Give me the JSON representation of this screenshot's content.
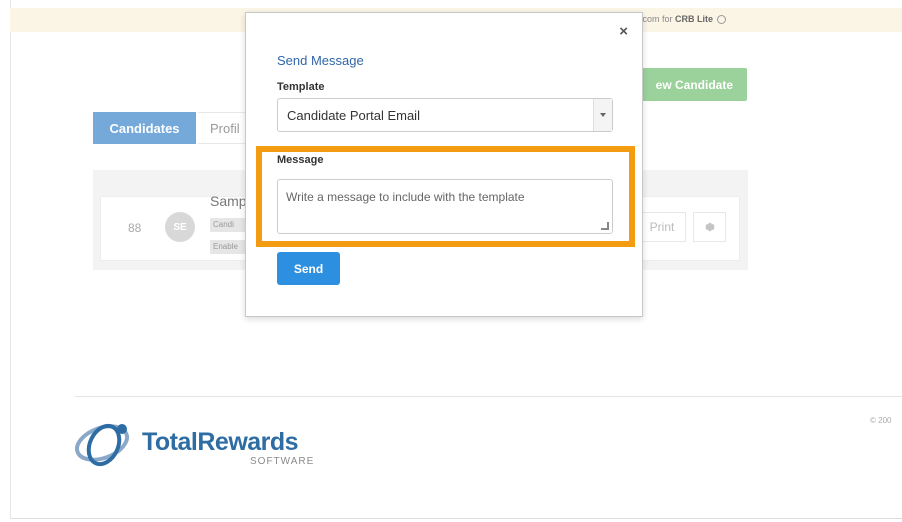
{
  "banner": {
    "text_prefix": "re.com for ",
    "text_bold": "CRB Lite"
  },
  "header": {
    "new_candidate_label": "ew Candidate"
  },
  "tabs": {
    "candidates": "Candidates",
    "profile": "Profil"
  },
  "row": {
    "number": "88",
    "avatar_initials": "SE",
    "name": "Samp",
    "tag1": "Candi",
    "tag2": "Enable",
    "print_label": "Print"
  },
  "footer": {
    "copyright": "© 200",
    "logo_word": "TotalRewards",
    "logo_sub": "SOFTWARE"
  },
  "modal": {
    "title": "Send Message",
    "template_label": "Template",
    "template_value": "Candidate Portal Email",
    "message_label": "Message",
    "message_placeholder": "Write a message to include with the template",
    "send_label": "Send",
    "close_glyph": "×"
  },
  "colors": {
    "highlight": "#f39c12",
    "send_button": "#2d8fe0",
    "tab_active": "#5c9bd4",
    "new_candidate_button": "#9bd29b",
    "brand": "#2e6da4"
  },
  "icons": {
    "close": "close-icon",
    "gear": "gear-icon",
    "select_arrow": "chevron-down-icon",
    "banner_help": "help-circle-icon"
  }
}
